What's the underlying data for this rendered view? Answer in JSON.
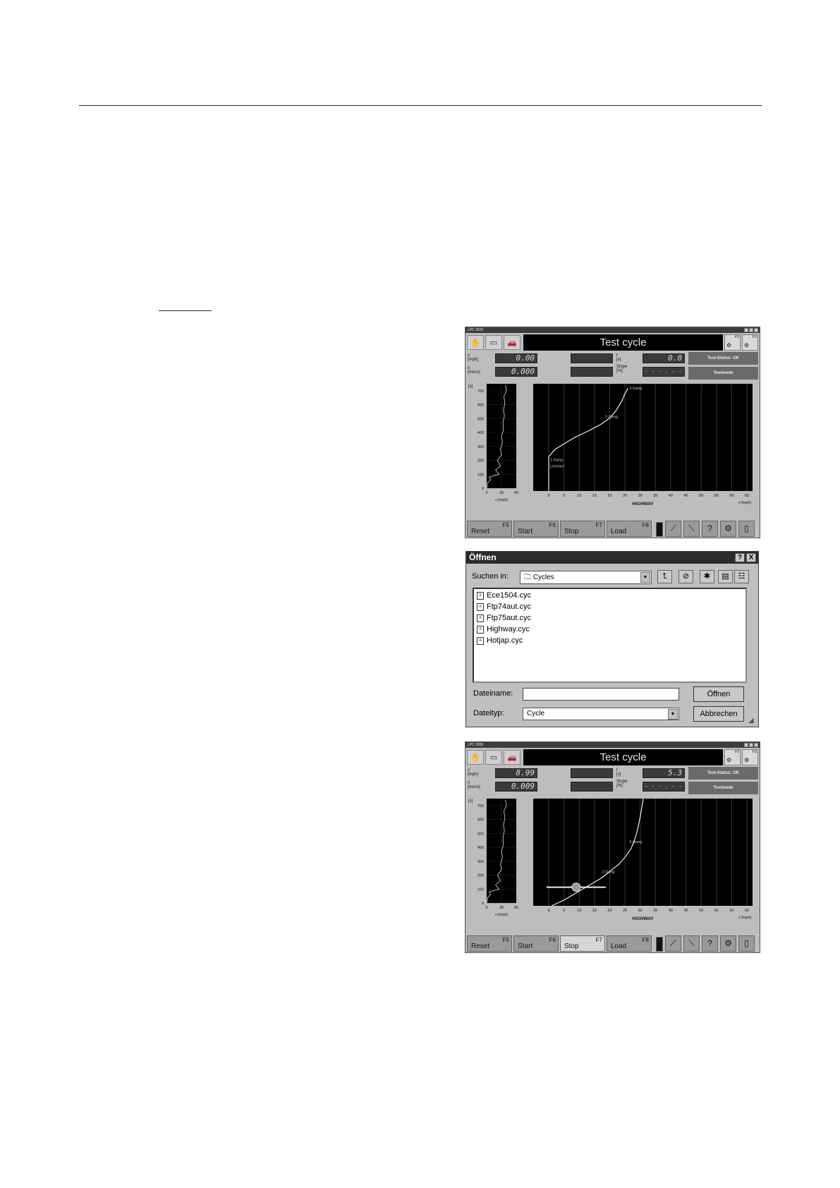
{
  "lpc_common": {
    "title": "LPC 2000",
    "banner": "Test cycle",
    "fkeys": [
      {
        "label": "F2",
        "glyph": "⚙"
      },
      {
        "label": "F3",
        "glyph": "⚙"
      }
    ],
    "labels": {
      "v": "v",
      "v_unit": "[mph]",
      "n": "n",
      "n_unit": "[min/s]",
      "t": "t",
      "t_unit": "[s]",
      "slope": "Slope",
      "slope_unit": "[%]"
    },
    "mode": "Testmode",
    "side_axis": {
      "unit": "[s]",
      "y_ticks": [
        "700",
        "600",
        "500",
        "400",
        "300",
        "200",
        "100",
        "0"
      ],
      "x_ticks": [
        "0",
        "30",
        "60"
      ],
      "xlabel": "v [mph]"
    },
    "main_axis": {
      "x_ticks": [
        "0",
        "5",
        "10",
        "15",
        "20",
        "25",
        "30",
        "35",
        "40",
        "45",
        "50",
        "55",
        "60",
        "65"
      ],
      "xlabel": "HIGHWAY",
      "xunit": "v [mph]"
    },
    "buttons": [
      {
        "name": "Reset",
        "fkey": "F5"
      },
      {
        "name": "Start",
        "fkey": "F6"
      },
      {
        "name": "Stop",
        "fkey": "F7"
      },
      {
        "name": "Load",
        "fkey": "F8"
      }
    ],
    "icon_names": [
      "gear-up-icon",
      "gear-down-icon",
      "help-icon",
      "dyno-icon",
      "exit-icon"
    ]
  },
  "window1": {
    "v_value": "0.00",
    "n_value": "0.000",
    "t_value": "0.0",
    "slope_value": "- - - . - -",
    "status": "Test-Status: OK",
    "active_button": -1,
    "gear_labels": [
      "3.Gang",
      "2.Gang",
      "1.Gang",
      "Leerlauf"
    ]
  },
  "window2": {
    "v_value": "8.99",
    "n_value": "0.009",
    "t_value": "5.3",
    "slope_value": "- - - . - -",
    "status": "Test-Status: OK",
    "active_button": 2,
    "gear_labels": [
      "3.Gang",
      "2.Gang"
    ]
  },
  "chart_data": [
    {
      "type": "line",
      "title": "HIGHWAY",
      "xlabel": "v [mph]",
      "ylabel": "[s]",
      "x": [
        0,
        5,
        10,
        15,
        20,
        25
      ],
      "xlim": [
        0,
        65
      ],
      "ylim": [
        0,
        750
      ],
      "grid": true,
      "series": [
        {
          "x": [
            0,
            0,
            2,
            5,
            9,
            13,
            17,
            20,
            22,
            24,
            25,
            26
          ],
          "y": [
            0,
            240,
            290,
            330,
            380,
            420,
            465,
            510,
            560,
            630,
            680,
            720
          ]
        }
      ],
      "annotations": [
        {
          "text": "3.Gang",
          "x": 26,
          "y": 720
        },
        {
          "text": "2.Gang",
          "x": 18,
          "y": 520
        },
        {
          "text": "1.Gang",
          "x": 0,
          "y": 220
        },
        {
          "text": "Leerlauf",
          "x": 0,
          "y": 175
        }
      ]
    },
    {
      "type": "line",
      "title": "HIGHWAY",
      "xlabel": "v [mph]",
      "ylabel": "[s]",
      "xlim": [
        0,
        65
      ],
      "ylim": [
        0,
        750
      ],
      "grid": true,
      "series": [
        {
          "x": [
            1,
            5,
            9,
            13,
            17,
            20,
            23,
            25,
            27,
            28,
            29,
            30,
            31
          ],
          "y": [
            0,
            40,
            90,
            140,
            190,
            240,
            290,
            340,
            400,
            450,
            520,
            620,
            750
          ]
        }
      ],
      "cursor": {
        "x": 9,
        "y": 130
      },
      "annotations": [
        {
          "text": "3.Gang",
          "x": 26,
          "y": 450
        },
        {
          "text": "2.Gang",
          "x": 17,
          "y": 240
        }
      ]
    }
  ],
  "side_trace": [
    [
      0,
      0
    ],
    [
      2,
      40
    ],
    [
      8,
      60
    ],
    [
      5,
      80
    ],
    [
      25,
      100
    ],
    [
      18,
      130
    ],
    [
      28,
      160
    ],
    [
      22,
      200
    ],
    [
      30,
      240
    ],
    [
      28,
      280
    ],
    [
      32,
      330
    ],
    [
      30,
      370
    ],
    [
      34,
      420
    ],
    [
      33,
      470
    ],
    [
      36,
      520
    ],
    [
      34,
      560
    ],
    [
      37,
      610
    ],
    [
      35,
      660
    ],
    [
      40,
      700
    ],
    [
      38,
      740
    ]
  ],
  "dialog": {
    "title": "Öffnen",
    "help": "?",
    "close": "X",
    "look_in_label": "Suchen in:",
    "look_in_value": "Cycles",
    "files": [
      "Ece1504.cyc",
      "Ftp74aut.cyc",
      "Ftp75aut.cyc",
      "Highway.cyc",
      "Hotjap.cyc"
    ],
    "filename_label": "Dateiname:",
    "filename_value": "",
    "filetype_label": "Dateityp:",
    "filetype_value": "Cycle",
    "open_button": "Öffnen",
    "cancel_button": "Abbrechen"
  }
}
